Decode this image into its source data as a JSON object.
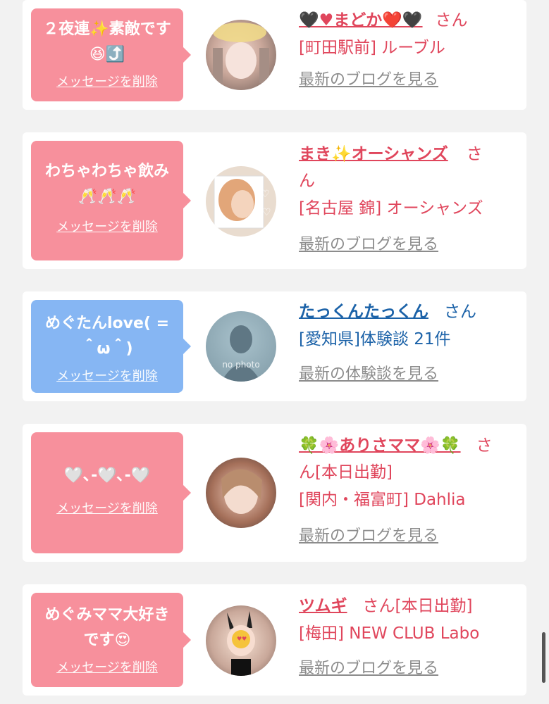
{
  "cards": [
    {
      "message_line1": "２夜連✨素敵です",
      "message_line2": "😆⤴️",
      "delete_label": "メッセージを削除",
      "name": "🖤♥まどか❤️🖤",
      "san": "さん",
      "shop": "[町田駅前] ルーブル",
      "blog": "最新のブログを見る"
    },
    {
      "message_line1": "わちゃわちゃ飲み",
      "message_line2": "🥂🥂🥂",
      "delete_label": "メッセージを削除",
      "name": "まき✨オーシャンズ",
      "san": "さ",
      "san2": "ん",
      "shop": "[名古屋 錦] オーシャンズ",
      "blog": "最新のブログを見る"
    },
    {
      "message_line1": "めぐたんlove( =",
      "message_line2": "＾ω＾)",
      "delete_label": "メッセージを削除",
      "name": "たっくんたっくん",
      "san": "さん",
      "shop": "[愛知県]体験談 21件",
      "blog": "最新の体験談を見る",
      "avatar_text": "no photo"
    },
    {
      "message_line1": "🤍､-🤍､-🤍",
      "delete_label": "メッセージを削除",
      "name": "🍀🌸ありさママ🌸🍀",
      "san": "さ",
      "san2": "ん[本日出勤]",
      "shop": "[関内・福富町] Dahlia",
      "blog": "最新のブログを見る"
    },
    {
      "message_line1": "めぐみママ大好き",
      "message_line2": "です😍",
      "delete_label": "メッセージを削除",
      "name": "ツムギ",
      "san": "さん[本日出勤]",
      "shop": "[梅田] NEW CLUB Labo",
      "blog": "最新のブログを見る"
    }
  ],
  "colors": {
    "pink_bubble": "#f7909c",
    "blue_bubble": "#86b6f3",
    "pink_text": "#e0465c",
    "blue_text": "#1b62a8"
  }
}
